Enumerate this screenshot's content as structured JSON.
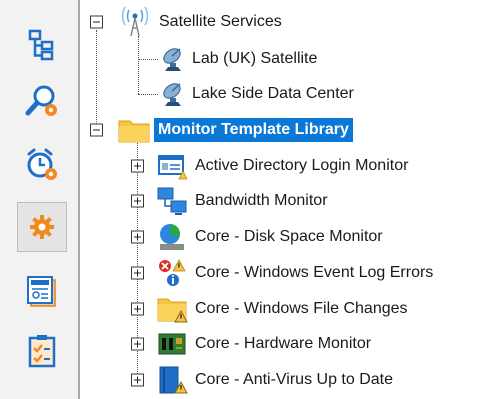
{
  "sidebar": {
    "buttons": [
      {
        "icon": "hierarchy-icon"
      },
      {
        "icon": "search-settings-icon"
      },
      {
        "icon": "alarm-clock-settings-icon"
      },
      {
        "icon": "gear-icon",
        "active": true
      },
      {
        "icon": "news-report-icon"
      },
      {
        "icon": "checklist-icon"
      }
    ]
  },
  "tree": {
    "satellite_group": {
      "label": "Satellite Services",
      "items": [
        {
          "label": "Lab (UK) Satellite"
        },
        {
          "label": "Lake Side Data Center"
        }
      ]
    },
    "library": {
      "label": "Monitor Template Library",
      "items": [
        {
          "label": "Active Directory Login Monitor"
        },
        {
          "label": "Bandwidth Monitor"
        },
        {
          "label": "Core - Disk Space Monitor"
        },
        {
          "label": "Core - Windows Event Log Errors"
        },
        {
          "label": "Core - Windows File Changes"
        },
        {
          "label": "Core - Hardware Monitor"
        },
        {
          "label": "Core - Anti-Virus Up to Date"
        }
      ]
    }
  },
  "colors": {
    "selection": "#0a78d7",
    "accent_orange": "#f08a1e",
    "icon_blue": "#1e6fc8"
  }
}
